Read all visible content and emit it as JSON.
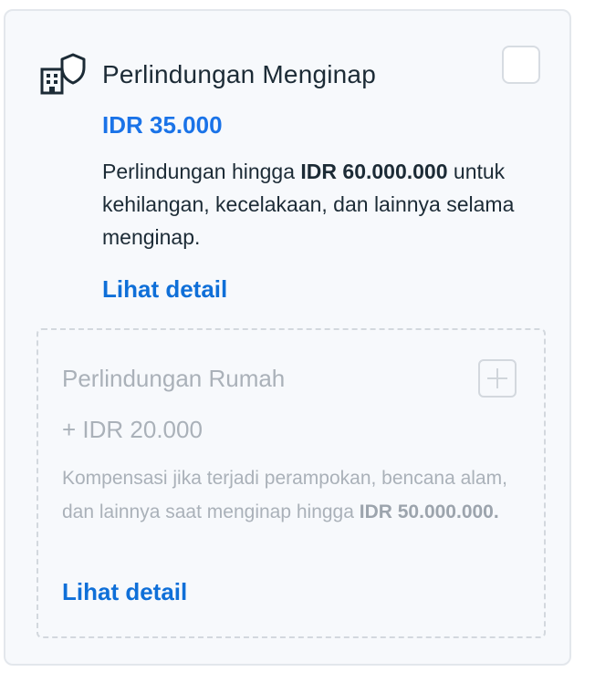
{
  "main": {
    "title": "Perlindungan Menginap",
    "price": "IDR 35.000",
    "desc_pre": "Perlindungan hingga ",
    "desc_bold": "IDR 60.000.000",
    "desc_post": " untuk kehilangan, kecelakaan, dan lainnya selama menginap.",
    "link_label": "Lihat detail",
    "icon": "building-shield-icon",
    "checked": false
  },
  "addon": {
    "title": "Perlindungan Rumah",
    "price": "+ IDR 20.000",
    "desc_pre": "Kompensasi jika terjadi perampokan, bencana alam, dan lainnya saat menginap hingga ",
    "desc_bold": "IDR 50.000.000.",
    "link_label": "Lihat detail",
    "icon": "plus-icon"
  },
  "colors": {
    "accent": "#1a73e8",
    "card_background": "#f7f9fc",
    "text": "#1c2b36",
    "disabled_text": "#aab1b9"
  }
}
